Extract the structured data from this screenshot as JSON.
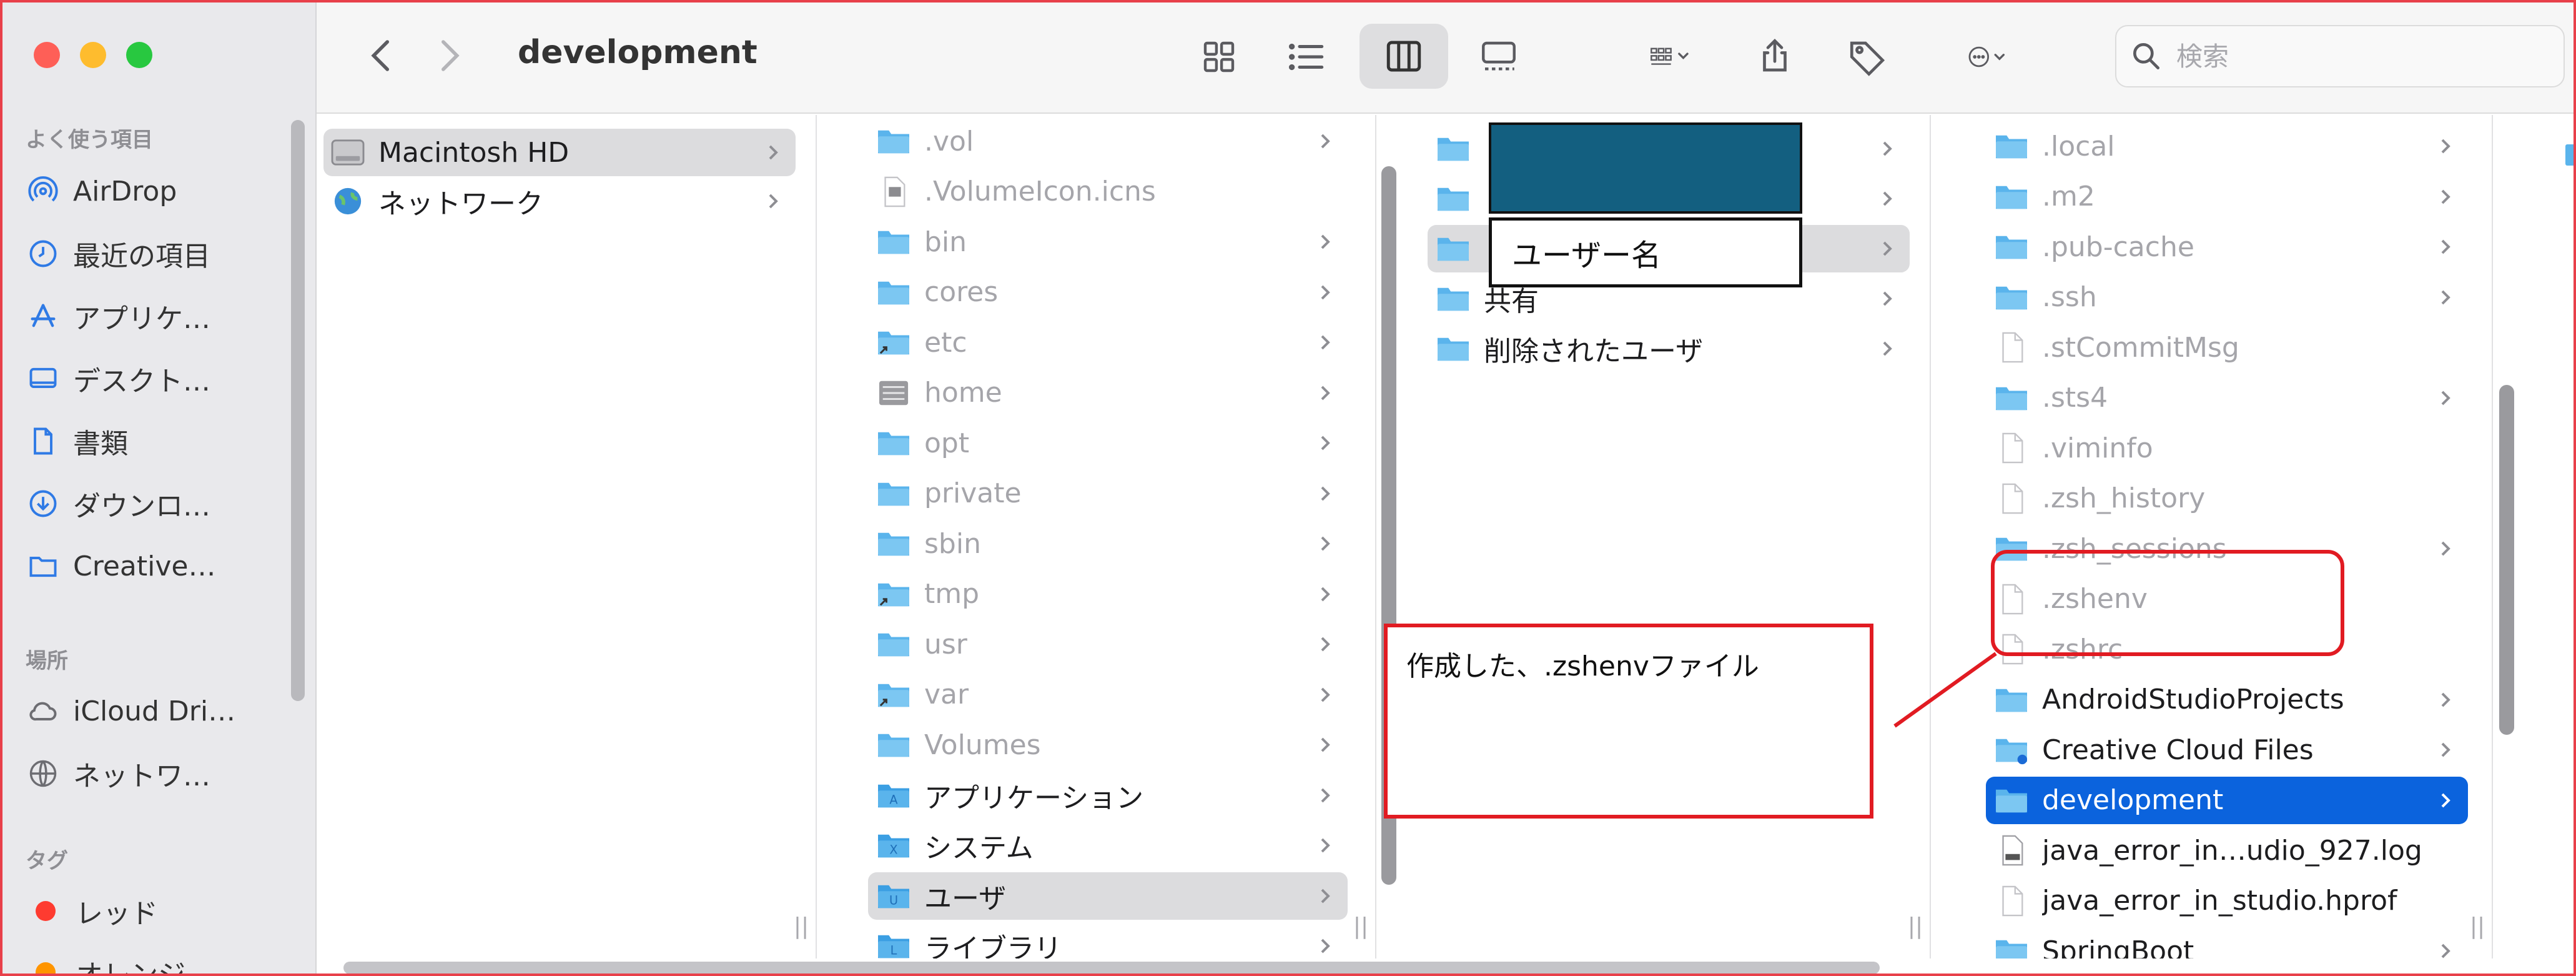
{
  "window": {
    "title": "development"
  },
  "search": {
    "placeholder": "検索"
  },
  "sidebar": {
    "sections": [
      {
        "title": "よく使う項目"
      },
      {
        "title": "場所"
      },
      {
        "title": "タグ"
      }
    ],
    "favorites": [
      {
        "label": "AirDrop",
        "icon": "airdrop-icon"
      },
      {
        "label": "最近の項目",
        "icon": "clock-icon"
      },
      {
        "label": "アプリケ…",
        "icon": "applications-icon"
      },
      {
        "label": "デスクト…",
        "icon": "desktop-icon"
      },
      {
        "label": "書類",
        "icon": "document-icon"
      },
      {
        "label": "ダウンロ…",
        "icon": "download-icon"
      },
      {
        "label": "Creative…",
        "icon": "folder-icon"
      }
    ],
    "locations": [
      {
        "label": "iCloud Dri…",
        "icon": "cloud-icon"
      },
      {
        "label": "ネットワ…",
        "icon": "globe-icon"
      }
    ],
    "tags": [
      {
        "label": "レッド",
        "color": "#fe3b30"
      },
      {
        "label": "オレンジ",
        "color": "#ff9500"
      }
    ]
  },
  "columns": {
    "col1": [
      {
        "label": "Macintosh HD",
        "icon": "hard-drive-icon"
      },
      {
        "label": "ネットワーク",
        "icon": "globe-icon"
      }
    ],
    "col2": [
      {
        "label": ".vol",
        "icon": "folder-icon"
      },
      {
        "label": ".VolumeIcon.icns",
        "icon": "icns-file-icon"
      },
      {
        "label": "bin",
        "icon": "folder-icon"
      },
      {
        "label": "cores",
        "icon": "folder-icon"
      },
      {
        "label": "etc",
        "icon": "alias-folder-icon"
      },
      {
        "label": "home",
        "icon": "server-folder-icon"
      },
      {
        "label": "opt",
        "icon": "folder-icon"
      },
      {
        "label": "private",
        "icon": "folder-icon"
      },
      {
        "label": "sbin",
        "icon": "folder-icon"
      },
      {
        "label": "tmp",
        "icon": "alias-folder-icon"
      },
      {
        "label": "usr",
        "icon": "folder-icon"
      },
      {
        "label": "var",
        "icon": "alias-folder-icon"
      },
      {
        "label": "Volumes",
        "icon": "folder-icon"
      },
      {
        "label": "アプリケーション",
        "icon": "applications-folder-icon"
      },
      {
        "label": "システム",
        "icon": "system-folder-icon"
      },
      {
        "label": "ユーザ",
        "icon": "users-folder-icon"
      },
      {
        "label": "ライブラリ",
        "icon": "library-folder-icon"
      }
    ],
    "col3": [
      {
        "label": "",
        "icon": "folder-icon"
      },
      {
        "label": "",
        "icon": "folder-icon"
      },
      {
        "label": "",
        "icon": "home-folder-icon"
      },
      {
        "label": "共有",
        "icon": "folder-icon"
      },
      {
        "label": "削除されたユーザ",
        "icon": "folder-icon"
      }
    ],
    "col4": [
      {
        "label": ".local",
        "icon": "folder-icon"
      },
      {
        "label": ".m2",
        "icon": "folder-icon"
      },
      {
        "label": ".pub-cache",
        "icon": "folder-icon"
      },
      {
        "label": ".ssh",
        "icon": "folder-icon"
      },
      {
        "label": ".stCommitMsg",
        "icon": "file-icon"
      },
      {
        "label": ".sts4",
        "icon": "folder-icon"
      },
      {
        "label": ".viminfo",
        "icon": "file-icon"
      },
      {
        "label": ".zsh_history",
        "icon": "file-icon"
      },
      {
        "label": ".zsh_sessions",
        "icon": "folder-icon"
      },
      {
        "label": ".zshenv",
        "icon": "file-icon"
      },
      {
        "label": ".zshrc",
        "icon": "file-icon"
      },
      {
        "label": "AndroidStudioProjects",
        "icon": "folder-icon"
      },
      {
        "label": "Creative Cloud Files",
        "icon": "creative-cloud-folder-icon"
      },
      {
        "label": "development",
        "icon": "folder-icon"
      },
      {
        "label": "java_error_in…udio_927.log",
        "icon": "log-file-icon"
      },
      {
        "label": "java_error_in_studio.hprof",
        "icon": "file-icon"
      },
      {
        "label": "SpringBoot",
        "icon": "folder-icon"
      }
    ]
  },
  "annotations": {
    "username": "ユーザー名",
    "note": "作成した、.zshenvファイル"
  },
  "colors": {
    "accent": "#0b63dd",
    "folder": "#5ab4ec",
    "annotation": "#e11b22",
    "redaction": "#135f80"
  }
}
